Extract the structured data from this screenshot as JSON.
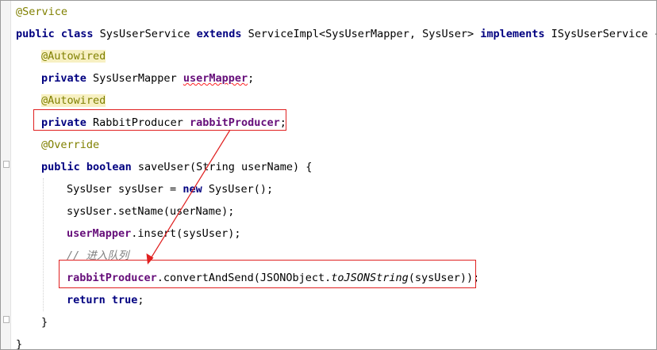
{
  "editor": {
    "language": "java",
    "lines": [
      [
        {
          "t": "@Service",
          "s": "ann"
        }
      ],
      [
        {
          "t": "public class ",
          "s": "kw"
        },
        {
          "t": "SysUserService "
        },
        {
          "t": "extends ",
          "s": "kw"
        },
        {
          "t": "ServiceImpl<SysUserMapper, SysUser> "
        },
        {
          "t": "implements ",
          "s": "kw"
        },
        {
          "t": "ISysUserService {"
        }
      ],
      [
        {
          "t": "@Autowired",
          "s": "ann-hl"
        }
      ],
      [
        {
          "t": "private ",
          "s": "kw"
        },
        {
          "t": "SysUserMapper "
        },
        {
          "t": "userMapper",
          "s": "fld-err"
        },
        {
          "t": ";"
        }
      ],
      [
        {
          "t": "@Autowired",
          "s": "ann-hl"
        }
      ],
      [
        {
          "t": "private ",
          "s": "kw"
        },
        {
          "t": "RabbitProducer "
        },
        {
          "t": "rabbitProducer",
          "s": "fld"
        },
        {
          "t": ";"
        }
      ],
      [
        {
          "t": "@Override",
          "s": "ann"
        }
      ],
      [
        {
          "t": "public boolean ",
          "s": "kw"
        },
        {
          "t": "saveUser(String userName) {"
        }
      ],
      [
        {
          "t": "SysUser sysUser = "
        },
        {
          "t": "new ",
          "s": "kw"
        },
        {
          "t": "SysUser();"
        }
      ],
      [
        {
          "t": "sysUser.setName(userName);"
        }
      ],
      [
        {
          "t": "userMapper",
          "s": "fld"
        },
        {
          "t": ".insert(sysUser);"
        }
      ],
      [
        {
          "t": "// 进入队列",
          "s": "cmt"
        }
      ],
      [
        {
          "t": "rabbitProducer",
          "s": "fld"
        },
        {
          "t": ".convertAndSend(JSONObject."
        },
        {
          "t": "toJSONString",
          "s": "stat"
        },
        {
          "t": "(sysUser));"
        }
      ],
      [
        {
          "t": "return true",
          "s": "kw"
        },
        {
          "t": ";"
        }
      ],
      [
        {
          "t": "}"
        }
      ],
      [
        {
          "t": "}"
        }
      ]
    ]
  },
  "annotations": {
    "box_color": "#e02020",
    "arrow": "rabbitProducer field declaration → rabbitProducer.convertAndSend call"
  }
}
